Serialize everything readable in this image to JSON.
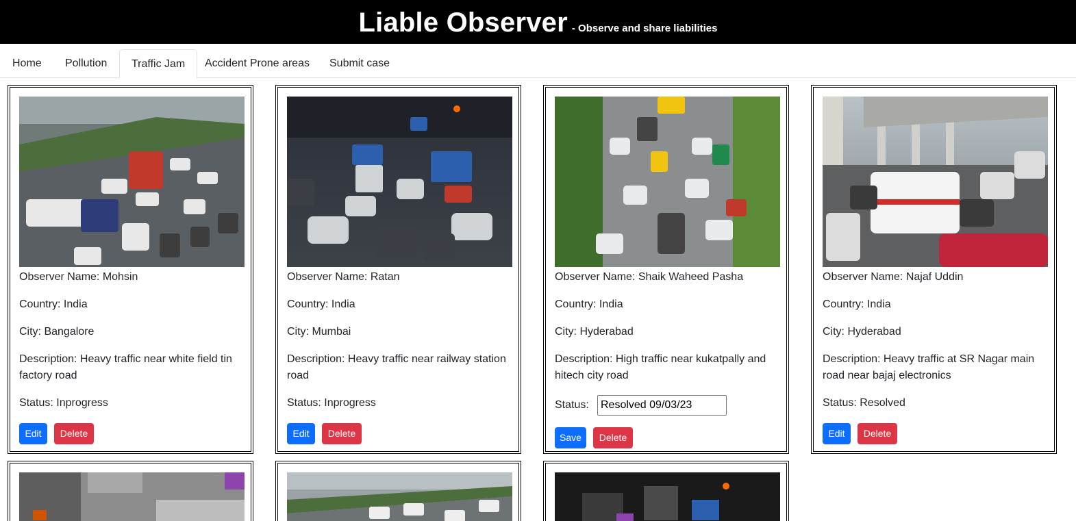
{
  "header": {
    "title": "Liable Observer",
    "subtitle": "- Observe and share liabilities"
  },
  "nav": {
    "tabs": [
      {
        "label": "Home"
      },
      {
        "label": "Pollution"
      },
      {
        "label": "Traffic Jam",
        "active": true
      },
      {
        "label": "Accident Prone areas"
      },
      {
        "label": "Submit case"
      }
    ]
  },
  "colors": {
    "primary_button": "#0d6efd",
    "danger_button": "#dc3545",
    "header_bg": "#000000"
  },
  "cases": [
    {
      "observer": "Observer Name: Mohsin",
      "country": "Country: India",
      "city": "City: Bangalore",
      "description": "Description: Heavy traffic near white field tin factory road",
      "status": "Status: Inprogress",
      "edit_label": "Edit",
      "delete_label": "Delete"
    },
    {
      "observer": "Observer Name: Ratan",
      "country": "Country: India",
      "city": "City: Mumbai",
      "description": "Description: Heavy traffic near railway station road",
      "status": "Status: Inprogress",
      "edit_label": "Edit",
      "delete_label": "Delete"
    },
    {
      "observer": "Observer Name: Shaik Waheed Pasha",
      "country": "Country: India",
      "city": "City: Hyderabad",
      "description": "Description: High traffic near kukatpally and hitech city road",
      "status_label": "Status:",
      "status_value": "Resolved 09/03/23",
      "save_label": "Save",
      "delete_label": "Delete"
    },
    {
      "observer": "Observer Name: Najaf Uddin",
      "country": "Country: India",
      "city": "City: Hyderabad",
      "description": "Description: Heavy traffic at SR Nagar main road near bajaj electronics",
      "status": "Status: Resolved",
      "edit_label": "Edit",
      "delete_label": "Delete"
    }
  ]
}
